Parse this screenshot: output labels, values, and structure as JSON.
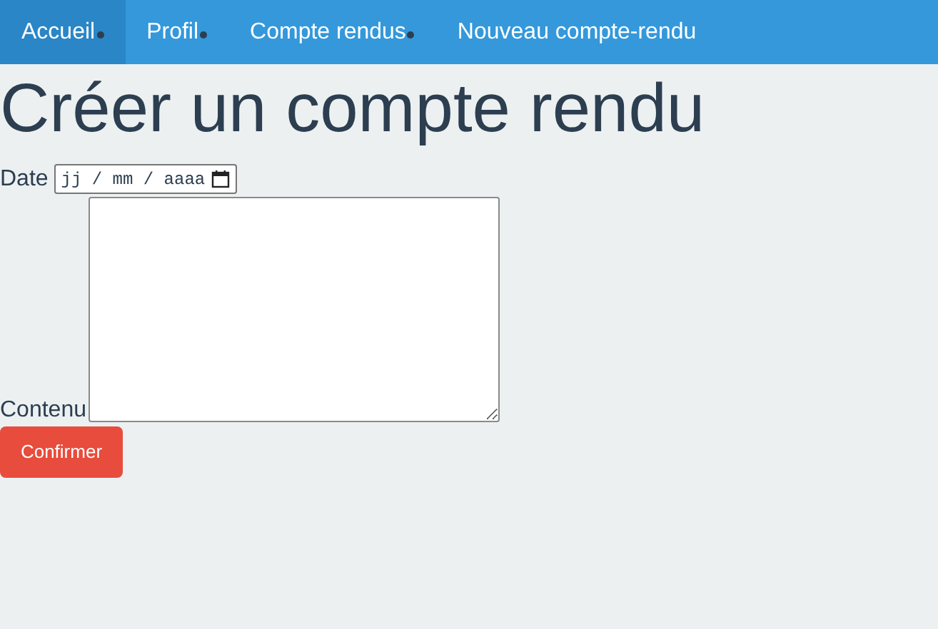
{
  "nav": [
    {
      "label": "Accueil",
      "selected": true,
      "dot": true
    },
    {
      "label": "Profil",
      "selected": false,
      "dot": true
    },
    {
      "label": "Compte rendus",
      "selected": false,
      "dot": true
    },
    {
      "label": "Nouveau compte-rendu",
      "selected": false,
      "dot": false
    }
  ],
  "heading": "Créer un compte rendu",
  "form": {
    "date_label": "Date",
    "date_placeholder": "jj / mm / aaaa",
    "content_label": "Contenu",
    "submit": "Confirmer"
  }
}
